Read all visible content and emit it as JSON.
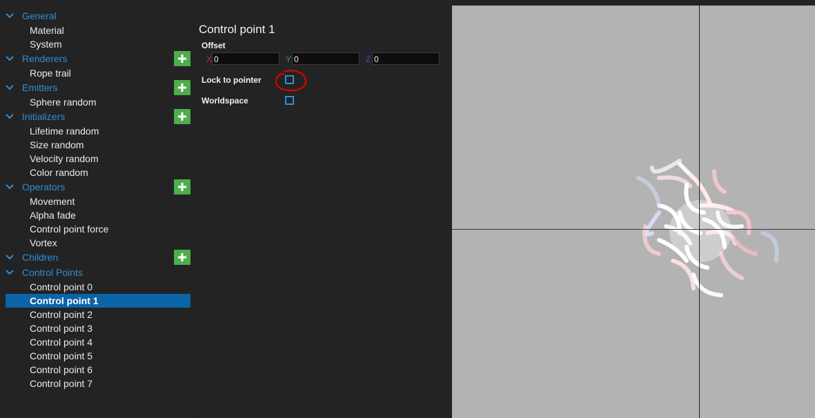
{
  "tree": {
    "categories": [
      {
        "label": "General",
        "items": [
          "Material",
          "System"
        ],
        "has_add": false
      },
      {
        "label": "Renderers",
        "items": [
          "Rope trail"
        ],
        "has_add": true
      },
      {
        "label": "Emitters",
        "items": [
          "Sphere random"
        ],
        "has_add": true
      },
      {
        "label": "Initializers",
        "items": [
          "Lifetime random",
          "Size random",
          "Velocity random",
          "Color random"
        ],
        "has_add": true
      },
      {
        "label": "Operators",
        "items": [
          "Movement",
          "Alpha fade",
          "Control point force",
          "Vortex"
        ],
        "has_add": true
      },
      {
        "label": "Children",
        "items": [],
        "has_add": true
      },
      {
        "label": "Control Points",
        "items": [
          "Control point 0",
          "Control point 1",
          "Control point 2",
          "Control point 3",
          "Control point 4",
          "Control point 5",
          "Control point 6",
          "Control point 7"
        ],
        "has_add": false
      }
    ],
    "selected_item": "Control point 1",
    "colors": {
      "category": "#2f8ed6",
      "add_button": "#4cae4c",
      "selection": "#0a64a6"
    }
  },
  "properties": {
    "title": "Control point 1",
    "offset_label": "Offset",
    "x_label": "X",
    "x_value": "0",
    "y_label": "Y",
    "y_value": "0",
    "z_label": "Z",
    "z_value": "0",
    "lock_label": "Lock to pointer",
    "lock_checked": false,
    "worldspace_label": "Worldspace",
    "worldspace_checked": false,
    "axis_colors": {
      "x": "#d22323",
      "y": "#2ea02e",
      "z": "#3a4bd6"
    },
    "annotation_color": "#e00000"
  },
  "viewport": {
    "background": "#b3b3b3",
    "icon": "particle-effect"
  }
}
